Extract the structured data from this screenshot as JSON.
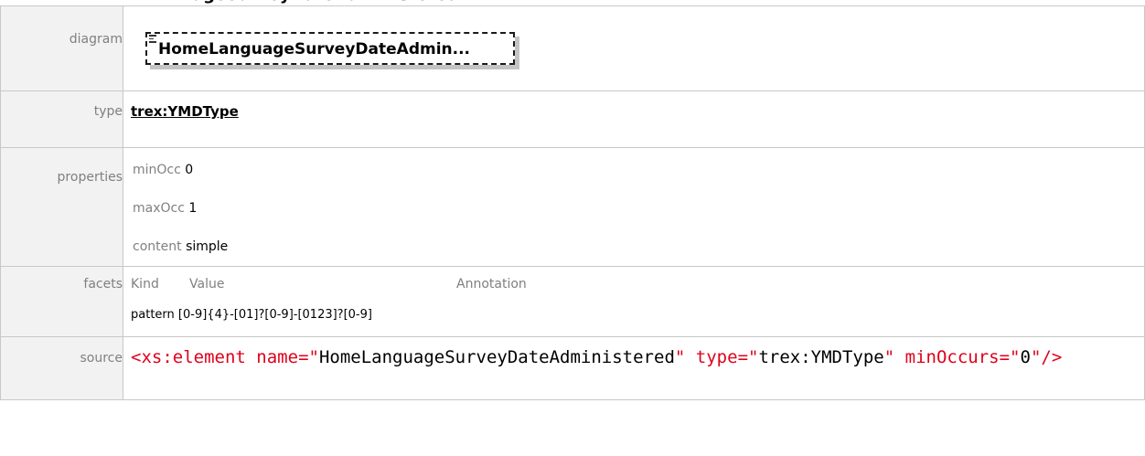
{
  "heading": "ageSurveyDateAdministered",
  "rows": {
    "diagram": {
      "label": "diagram",
      "element_name": "HomeLanguageSurveyDateAdmin..."
    },
    "type": {
      "label": "type",
      "value": "trex:YMDType"
    },
    "properties": {
      "label": "properties",
      "items": [
        {
          "key": "minOcc",
          "value": "0"
        },
        {
          "key": "maxOcc",
          "value": "1"
        },
        {
          "key": "content",
          "value": "simple"
        }
      ]
    },
    "facets": {
      "label": "facets",
      "columns": [
        "Kind",
        "Value",
        "Annotation"
      ],
      "entries": [
        {
          "kind": "pattern",
          "value": "[0-9]{4}-[01]?[0-9]-[0123]?[0-9]"
        }
      ]
    },
    "source": {
      "label": "source",
      "open_tag": "<xs:element",
      "name_attr": "name",
      "eq": "=\"",
      "name_value": "HomeLanguageSurveyDateAdministered",
      "quote": "\"",
      "type_attr": "type",
      "type_value": "trex:YMDType",
      "min_attr": "minOccurs",
      "min_value": "0",
      "close": "\"/>"
    }
  },
  "colors": {
    "label_bg": "#f2f2f2",
    "label_text": "#808080",
    "border": "#c8c8c8",
    "xml_markup": "#e0001b"
  }
}
